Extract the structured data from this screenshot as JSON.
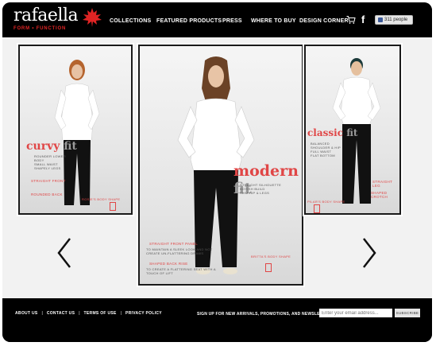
{
  "brand": {
    "name": "rafaella",
    "tagline": "FORM • FUNCTION",
    "leaf_color": "#e02424"
  },
  "nav": {
    "items": [
      "COLLECTIONS",
      "FEATURED PRODUCTS",
      "PRESS",
      "WHERE TO BUY",
      "DESIGN CORNER"
    ]
  },
  "header_icons": {
    "cart": "shopping-cart-icon",
    "facebook": "f",
    "like_count": "311 people"
  },
  "carousel": {
    "cards": [
      {
        "title_red": "curvy",
        "title_gray": " fit",
        "desc": "Rounder lower body\nSmall waist\nShapely legs",
        "notes": [
          "Straight front",
          "Rounded back"
        ],
        "body_shape": "Rosie's body shape"
      },
      {
        "title_red": "modern",
        "title_gray": " fit",
        "desc": "Straight silhouette\nBoyish build\nSlim hip & legs",
        "notes": [
          "Straight front panel",
          "To maintain a sleek look and not create un-flattering draws",
          "Shaped back rise",
          "To create a flattering seat with a touch of lift"
        ],
        "body_shape": "Britta's body shape"
      },
      {
        "title_red": "classic",
        "title_gray": " fit",
        "desc": "Balanced shoulder & hip\nFull waist\nFlat bottom",
        "notes": [
          "Straight leg",
          "Shaped crotch"
        ],
        "body_shape": "Pilar's body shape"
      }
    ],
    "prev_icon": "chevron-left-icon",
    "next_icon": "chevron-right-icon"
  },
  "footer": {
    "links": [
      "ABOUT US",
      "CONTACT US",
      "TERMS OF USE",
      "PRIVACY POLICY"
    ],
    "signup_text": "SIGN UP FOR NEW ARRIVALS, PROMOTIONS, AND NEWSLETTER",
    "email_placeholder": "Enter your email address...",
    "subscribe_label": "SUBSCRIBE"
  },
  "colors": {
    "accent_red": "#e04646",
    "header_bg": "#000000",
    "content_bg": "#f2f2f2"
  }
}
